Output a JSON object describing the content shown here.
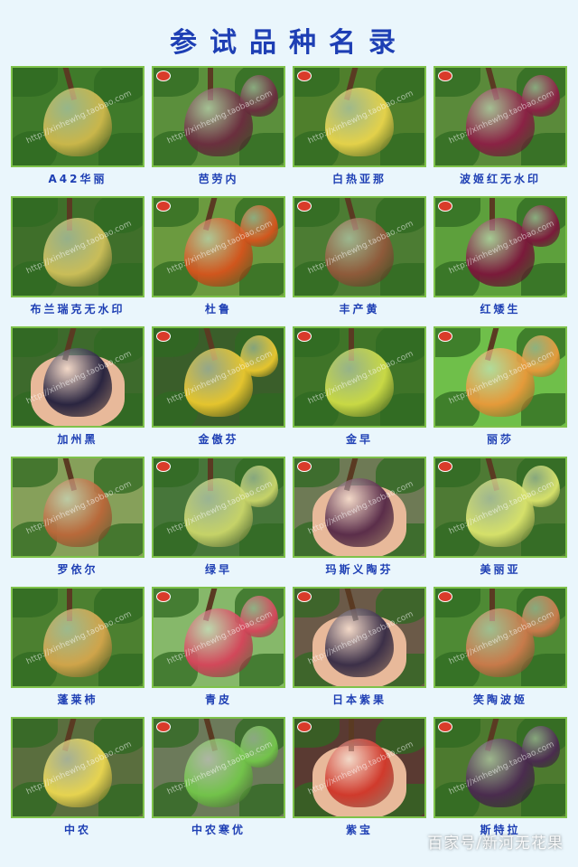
{
  "title": "参试品种名录",
  "footer_watermark": "百家号/新河无花果",
  "photo_watermark": "http://xinhewhg.taobao.com",
  "varieties": [
    {
      "name": "A42华丽",
      "fig": "#c9b64a",
      "bg": "#3f7a2a"
    },
    {
      "name": "芭劳内",
      "fig": "#6a2f3e",
      "bg": "#5b8f3c"
    },
    {
      "name": "白热亚那",
      "fig": "#e3d14a",
      "bg": "#4f7f2c"
    },
    {
      "name": "波姬红无水印",
      "fig": "#8a2244",
      "bg": "#5a8a3a"
    },
    {
      "name": "布兰瑞克无水印",
      "fig": "#c9bd58",
      "bg": "#3f6f2a"
    },
    {
      "name": "杜鲁",
      "fig": "#d0561d",
      "bg": "#6b9a3f"
    },
    {
      "name": "丰产黄",
      "fig": "#8e5a3a",
      "bg": "#4c7c33"
    },
    {
      "name": "红矮生",
      "fig": "#7a1a3a",
      "bg": "#5da03c"
    },
    {
      "name": "加州黑",
      "fig": "#2a2540",
      "bg": "#3d6a2c"
    },
    {
      "name": "金傲芬",
      "fig": "#e4c42e",
      "bg": "#3a5e2a"
    },
    {
      "name": "金早",
      "fig": "#c8d845",
      "bg": "#3f7428"
    },
    {
      "name": "丽莎",
      "fig": "#e49a3a",
      "bg": "#6fbf4a"
    },
    {
      "name": "罗依尔",
      "fig": "#b8693a",
      "bg": "#86a05a"
    },
    {
      "name": "绿早",
      "fig": "#c5d268",
      "bg": "#47763a"
    },
    {
      "name": "玛斯义陶芬",
      "fig": "#5b2e4a",
      "bg": "#6e7a55"
    },
    {
      "name": "美丽亚",
      "fig": "#d5e06a",
      "bg": "#4e7a34"
    },
    {
      "name": "蓬莱柿",
      "fig": "#cfa44a",
      "bg": "#4c8030"
    },
    {
      "name": "青皮",
      "fig": "#d2485a",
      "bg": "#86b86a"
    },
    {
      "name": "日本紫果",
      "fig": "#3c3048",
      "bg": "#6b5a48"
    },
    {
      "name": "笑陶波姬",
      "fig": "#c77a4a",
      "bg": "#4e8a34"
    },
    {
      "name": "中农",
      "fig": "#e6d350",
      "bg": "#5a6e3e"
    },
    {
      "name": "中农寒优",
      "fig": "#72c24a",
      "bg": "#6c7a5a"
    },
    {
      "name": "紫宝",
      "fig": "#d03a2c",
      "bg": "#5a3a32"
    },
    {
      "name": "斯特拉",
      "fig": "#4a2c4e",
      "bg": "#4d7a2f"
    }
  ]
}
